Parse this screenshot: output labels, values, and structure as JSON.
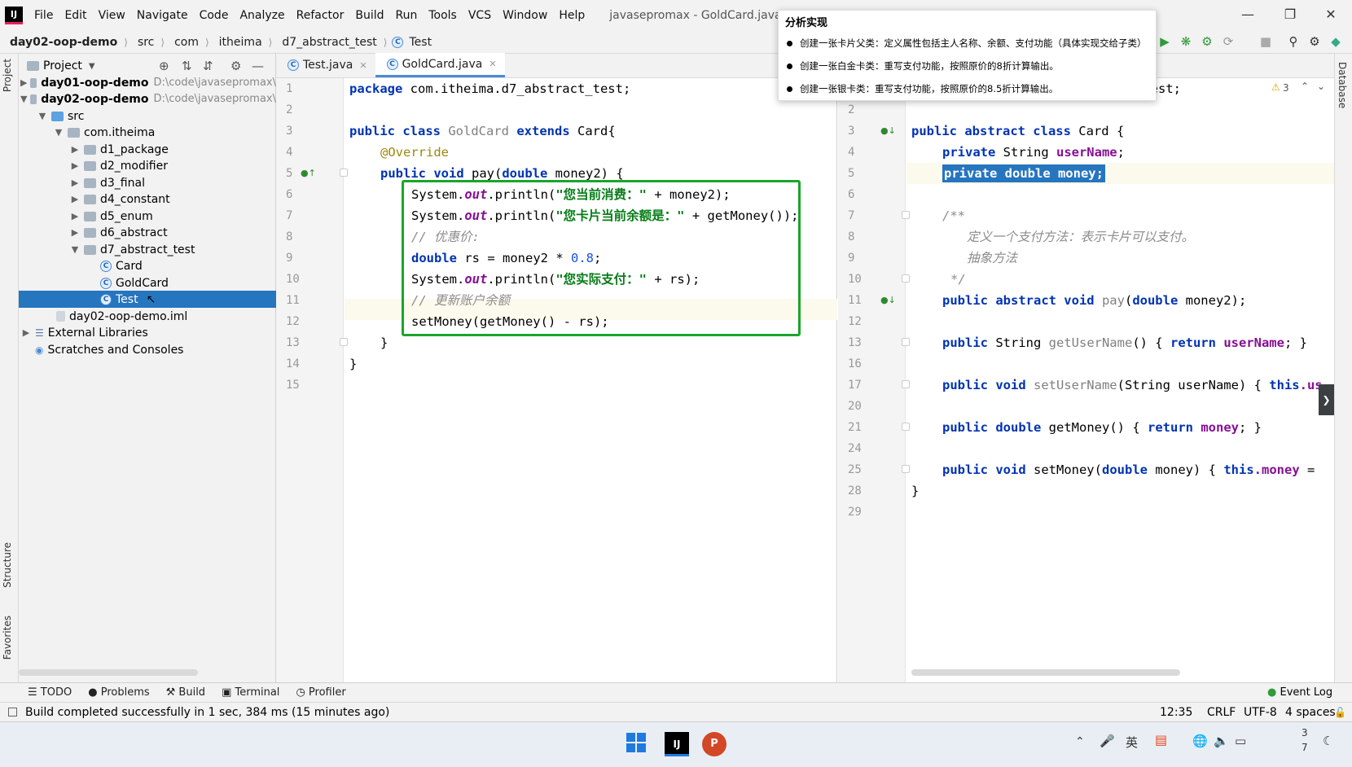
{
  "menubar": {
    "logo": "IJ",
    "items": [
      "File",
      "Edit",
      "View",
      "Navigate",
      "Code",
      "Analyze",
      "Refactor",
      "Build",
      "Run",
      "Tools",
      "VCS",
      "Window",
      "Help"
    ],
    "window_title": "javasepromax - GoldCard.java [day02-oop"
  },
  "breadcrumb": [
    "day02-oop-demo",
    "src",
    "com",
    "itheima",
    "d7_abstract_test",
    "Test"
  ],
  "project_panel": {
    "title": "Project",
    "tree": [
      {
        "label": "day01-oop-demo",
        "path": "D:\\code\\javasepromax\\"
      },
      {
        "label": "day02-oop-demo",
        "path": "D:\\code\\javasepromax\\"
      },
      {
        "label": "src"
      },
      {
        "label": "com.itheima"
      },
      {
        "label": "d1_package"
      },
      {
        "label": "d2_modifier"
      },
      {
        "label": "d3_final"
      },
      {
        "label": "d4_constant"
      },
      {
        "label": "d5_enum"
      },
      {
        "label": "d6_abstract"
      },
      {
        "label": "d7_abstract_test"
      },
      {
        "label": "Card"
      },
      {
        "label": "GoldCard"
      },
      {
        "label": "Test"
      },
      {
        "label": "day02-oop-demo.iml"
      },
      {
        "label": "External Libraries"
      },
      {
        "label": "Scratches and Consoles"
      }
    ]
  },
  "side_tabs": {
    "project": "Project",
    "structure": "Structure",
    "favorites": "Favorites",
    "database": "Database"
  },
  "editor_tabs": [
    {
      "label": "Test.java"
    },
    {
      "label": "GoldCard.java"
    }
  ],
  "left_editor": {
    "line_numbers": [
      "1",
      "2",
      "3",
      "4",
      "5",
      "6",
      "7",
      "8",
      "9",
      "10",
      "11",
      "12",
      "13",
      "14",
      "15"
    ],
    "code": {
      "l1_kw": "package",
      "l1_rest": " com.itheima.d7_abstract_test;",
      "l3_kw1": "public class",
      "l3_name": "GoldCard",
      "l3_kw2": "extends",
      "l3_rest": " Card{",
      "l4_ann": "@Override",
      "l5_kw": "public void",
      "l5_mid": " pay(",
      "l5_kw2": "double",
      "l5_rest": " money2) {",
      "l6_a": "System.",
      "l6_out": "out",
      "l6_b": ".println(",
      "l6_str": "\"您当前消费：\"",
      "l6_c": " + money2);",
      "l7_a": "System.",
      "l7_out": "out",
      "l7_b": ".println(",
      "l7_str": "\"您卡片当前余额是：\"",
      "l7_c": " + getMoney());",
      "l8_cm": "// 优惠价:",
      "l9_kw": "double",
      "l9_mid": " rs = money2 * ",
      "l9_num": "0.8",
      "l9_end": ";",
      "l10_a": "System.",
      "l10_out": "out",
      "l10_b": ".println(",
      "l10_str": "\"您实际支付：\"",
      "l10_c": " + rs);",
      "l11_cm": "// 更新账户余额",
      "l12": "setMoney(getMoney() - rs);",
      "l13": "}",
      "l14": "}"
    }
  },
  "right_editor": {
    "line_numbers": [
      "2",
      "3",
      "4",
      "5",
      "6",
      "7",
      "8",
      "9",
      "10",
      "11",
      "12",
      "13",
      "16",
      "17",
      "20",
      "21",
      "24",
      "25",
      "28",
      "29"
    ],
    "warning_count": "3",
    "top_partial": "_test;",
    "code": {
      "r3_kw": "public abstract class",
      "r3_rest": " Card {",
      "r4_kw": "private",
      "r4_mid": " String ",
      "r4_fld": "userName",
      "r4_end": ";",
      "r5": "private double money;",
      "r7": "/**",
      "r8": "定义一个支付方法：表示卡片可以支付。",
      "r9": "抽象方法",
      "r10": "*/",
      "r11_kw": "public abstract void",
      "r11_name": " pay",
      "r11_mid": "(",
      "r11_kw2": "double",
      "r11_end": " money2);",
      "r13_kw": "public",
      "r13_mid": " String ",
      "r13_name": "getUserName",
      "r13_a": "() { ",
      "r13_kw2": "return",
      "r13_fld": " userName",
      "r13_end": "; }",
      "r17_kw": "public void",
      "r17_name": " setUserName",
      "r17_a": "(String userName) { ",
      "r17_kw2": "this",
      ".r17_b": "",
      "r17_fld": ".us",
      "r21_kw": "public double",
      "r21_name": " getMoney",
      "r21_a": "() { ",
      "r21_kw2": "return",
      "r21_fld": " money",
      "r21_end": "; }",
      "r25_kw": "public void",
      "r25_name": " setMoney",
      "r25_a": "(",
      "r25_kw2": "double",
      "r25_b": " money) { ",
      "r25_kw3": "this",
      "r25_fld": ".money",
      "r25_end": " = ",
      "r28": "}"
    }
  },
  "analysis_popup": {
    "title": "分析实现",
    "items": [
      "创建一张卡片父类：定义属性包括主人名称、余额、支付功能（具体实现交给子类）",
      "创建一张白金卡类：重写支付功能，按照原价的8折计算输出。",
      "创建一张银卡类：重写支付功能，按照原价的8.5折计算输出。"
    ]
  },
  "tool_tabs": [
    "TODO",
    "Problems",
    "Build",
    "Terminal",
    "Profiler"
  ],
  "event_log": "Event Log",
  "status": {
    "message": "Build completed successfully in 1 sec, 384 ms (15 minutes ago)",
    "position": "12:35",
    "line_sep": "CRLF",
    "encoding": "UTF-8",
    "indent": "4 spaces"
  },
  "taskbar": {
    "clock_top": "3",
    "clock_bottom": "7",
    "ime": "英"
  }
}
